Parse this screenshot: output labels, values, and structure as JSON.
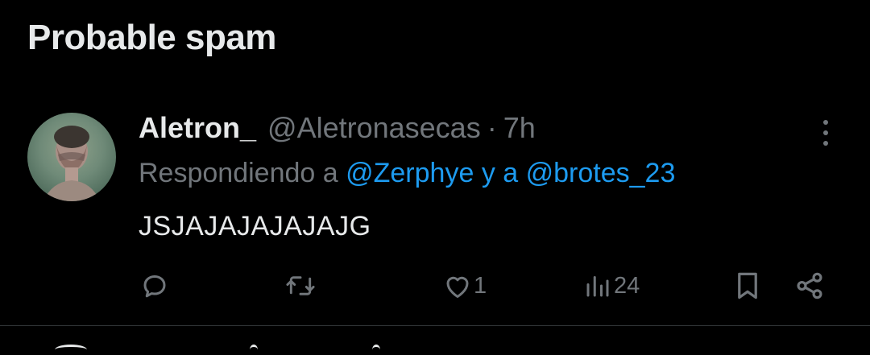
{
  "section": {
    "heading": "Probable spam"
  },
  "tweet": {
    "display_name": "Aletron_",
    "handle": "@Aletronasecas",
    "separator": "·",
    "time_ago": "7h",
    "reply_prefix": "Respondiendo a",
    "reply_mention_1": "@Zerphye",
    "reply_joiner": "y a",
    "reply_mention_2": "@brotes_23",
    "text": "JSJAJAJAJAJAJG",
    "avatar_icon": "profile-photo",
    "actions": {
      "reply_icon": "reply-icon",
      "retweet_icon": "retweet-icon",
      "like_icon": "heart-icon",
      "like_count": "1",
      "views_icon": "views-icon",
      "views_count": "24",
      "bookmark_icon": "bookmark-icon",
      "share_icon": "share-icon"
    }
  },
  "colors": {
    "background": "#000000",
    "primary_text": "#e7e9ea",
    "secondary_text": "#71767b",
    "link": "#1d9bf0",
    "divider": "#2f3336"
  }
}
